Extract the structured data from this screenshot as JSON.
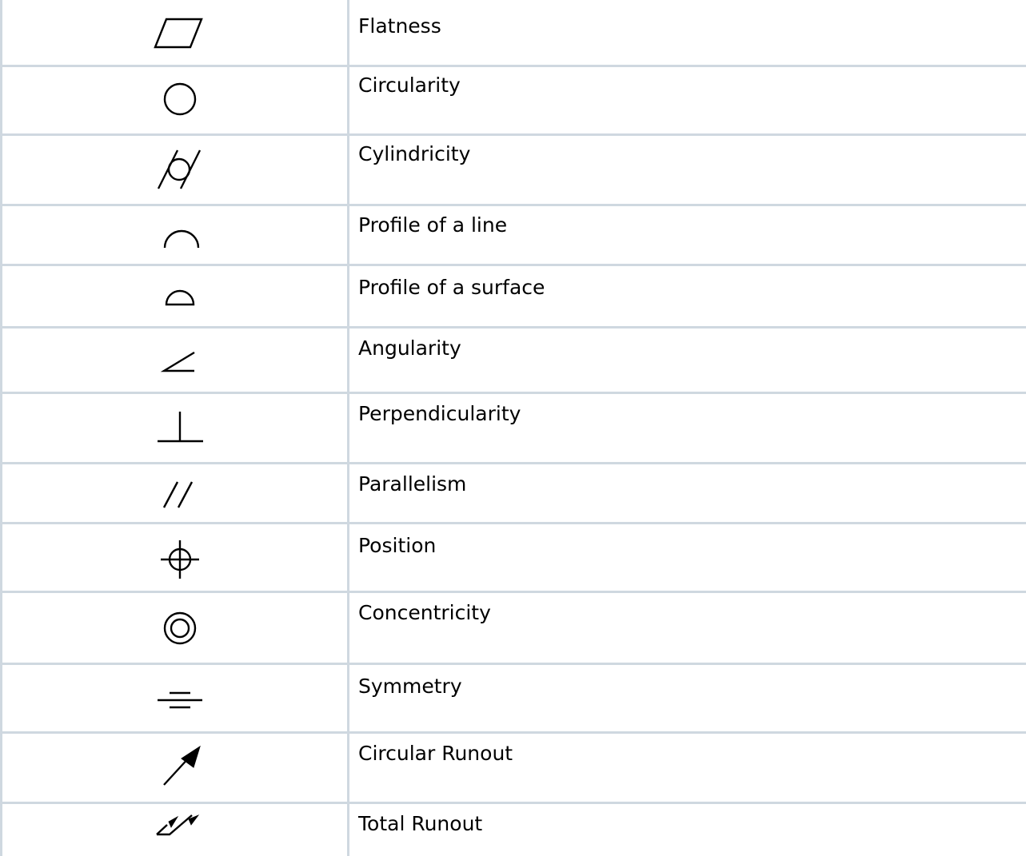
{
  "table": {
    "rows": [
      {
        "icon": "flatness-icon",
        "label": "Flatness"
      },
      {
        "icon": "circularity-icon",
        "label": "Circularity"
      },
      {
        "icon": "cylindricity-icon",
        "label": "Cylindricity"
      },
      {
        "icon": "profile-of-a-line-icon",
        "label": "Profile of a line"
      },
      {
        "icon": "profile-of-a-surface-icon",
        "label": "Profile of a surface"
      },
      {
        "icon": "angularity-icon",
        "label": "Angularity"
      },
      {
        "icon": "perpendicularity-icon",
        "label": "Perpendicularity"
      },
      {
        "icon": "parallelism-icon",
        "label": "Parallelism"
      },
      {
        "icon": "position-icon",
        "label": "Position"
      },
      {
        "icon": "concentricity-icon",
        "label": "Concentricity"
      },
      {
        "icon": "symmetry-icon",
        "label": "Symmetry"
      },
      {
        "icon": "circular-runout-icon",
        "label": "Circular Runout"
      },
      {
        "icon": "total-runout-icon",
        "label": "Total Runout"
      }
    ]
  },
  "colors": {
    "grid_line": "#cfd8e0",
    "text": "#000000",
    "background": "#ffffff"
  }
}
